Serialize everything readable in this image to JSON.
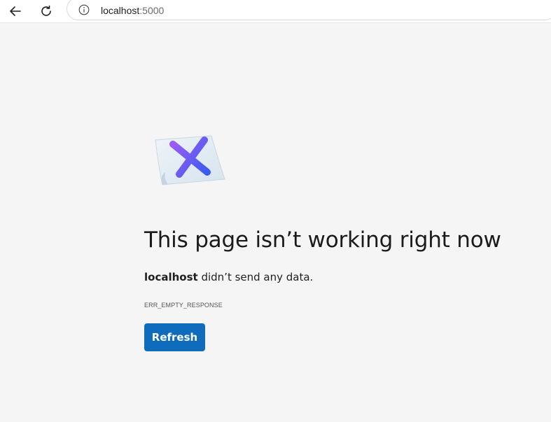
{
  "browser": {
    "back_icon": "arrow-left-icon",
    "reload_icon": "reload-icon",
    "site_info_icon": "info-circle-icon",
    "url_host": "localhost",
    "url_port": ":5000"
  },
  "error": {
    "art_icon": "error-x-note-icon",
    "title": "This page isn’t working right now",
    "message_host": "localhost",
    "message_rest": " didn’t send any data.",
    "code": "ERR_EMPTY_RESPONSE",
    "refresh_label": "Refresh"
  },
  "colors": {
    "page_background": "#f5f5f5",
    "button_primary": "#0f6cbd",
    "x_gradient_start": "#9b5cf5",
    "x_gradient_end": "#3b5bf0"
  }
}
